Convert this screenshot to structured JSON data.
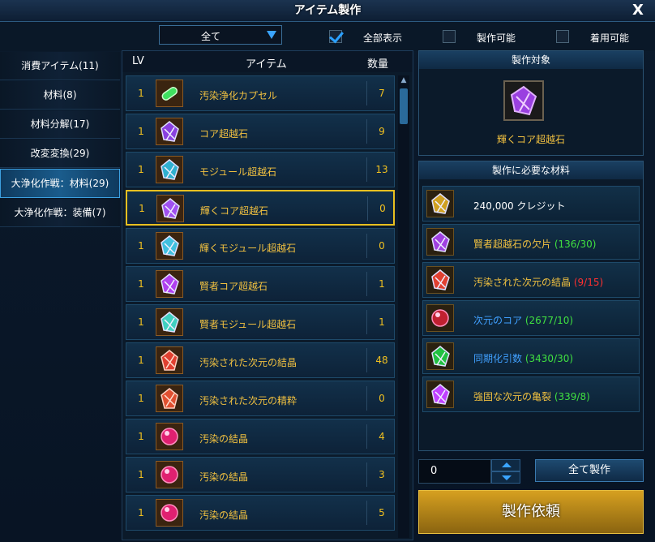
{
  "window": {
    "title": "アイテム製作",
    "close_label": "X"
  },
  "filters": {
    "dropdown_value": "全て",
    "checkboxes": [
      {
        "label": "全部表示",
        "checked": true
      },
      {
        "label": "製作可能",
        "checked": false
      },
      {
        "label": "着用可能",
        "checked": false
      }
    ]
  },
  "categories": [
    {
      "label": "消費アイテム(11)",
      "selected": false
    },
    {
      "label": "材料(8)",
      "selected": false
    },
    {
      "label": "材料分解(17)",
      "selected": false
    },
    {
      "label": "改変変換(29)",
      "selected": false
    },
    {
      "label": "大浄化作戦：材料(29)",
      "selected": true
    },
    {
      "label": "大浄化作戦：装備(7)",
      "selected": false
    }
  ],
  "list": {
    "headers": {
      "lv": "LV",
      "item": "アイテム",
      "qty": "数量"
    },
    "rows": [
      {
        "lv": "1",
        "name": "汚染浄化カプセル",
        "qty": "7",
        "icon": "capsule-icon",
        "color": "#40e060"
      },
      {
        "lv": "1",
        "name": "コア超越石",
        "qty": "9",
        "icon": "core-stone-icon",
        "color": "#8a40e0"
      },
      {
        "lv": "1",
        "name": "モジュール超越石",
        "qty": "13",
        "icon": "module-stone-icon",
        "color": "#30b0d0"
      },
      {
        "lv": "1",
        "name": "輝くコア超越石",
        "qty": "0",
        "icon": "core-stone-icon",
        "color": "#a050f0",
        "selected": true
      },
      {
        "lv": "1",
        "name": "輝くモジュール超越石",
        "qty": "0",
        "icon": "module-stone-icon",
        "color": "#40c0e0"
      },
      {
        "lv": "1",
        "name": "賢者コア超越石",
        "qty": "1",
        "icon": "core-stone-icon",
        "color": "#b040f0"
      },
      {
        "lv": "1",
        "name": "賢者モジュール超越石",
        "qty": "1",
        "icon": "module-stone-icon",
        "color": "#40d0c0"
      },
      {
        "lv": "1",
        "name": "汚染された次元の結晶",
        "qty": "48",
        "icon": "crystal-icon",
        "color": "#e04030"
      },
      {
        "lv": "1",
        "name": "汚染された次元の精粋",
        "qty": "0",
        "icon": "essence-icon",
        "color": "#e05030"
      },
      {
        "lv": "1",
        "name": "汚染の結晶",
        "qty": "4",
        "icon": "orb-icon",
        "color": "#e02070"
      },
      {
        "lv": "1",
        "name": "汚染の結晶",
        "qty": "3",
        "icon": "orb-icon",
        "color": "#e02070"
      },
      {
        "lv": "1",
        "name": "汚染の結晶",
        "qty": "5",
        "icon": "orb-icon",
        "color": "#e02070"
      }
    ]
  },
  "target": {
    "header": "製作対象",
    "name": "輝くコア超越石",
    "icon": "core-stone-icon"
  },
  "materials": {
    "header": "製作に必要な材料",
    "items": [
      {
        "name": "240,000 クレジット",
        "count": "",
        "name_color": "#ffffff",
        "count_color": "#ffffff",
        "icon": "credit-icon"
      },
      {
        "name": "賢者超越石の欠片",
        "count": "(136/30)",
        "name_color": "#f0c040",
        "count_color": "#40e040",
        "icon": "shard-icon"
      },
      {
        "name": "汚染された次元の結晶",
        "count": "(9/15)",
        "name_color": "#f0c040",
        "count_color": "#ff3030",
        "icon": "crystal-icon"
      },
      {
        "name": "次元のコア",
        "count": "(2677/10)",
        "name_color": "#40a0ff",
        "count_color": "#40e040",
        "icon": "orb-icon"
      },
      {
        "name": "同期化引数",
        "count": "(3430/30)",
        "name_color": "#40a0ff",
        "count_color": "#40e040",
        "icon": "sync-icon"
      },
      {
        "name": "強固な次元の亀裂",
        "count": "(339/8)",
        "name_color": "#f0c040",
        "count_color": "#40e040",
        "icon": "rift-icon"
      }
    ]
  },
  "actions": {
    "quantity": "0",
    "craft_all_label": "全て製作",
    "request_label": "製作依頼"
  }
}
